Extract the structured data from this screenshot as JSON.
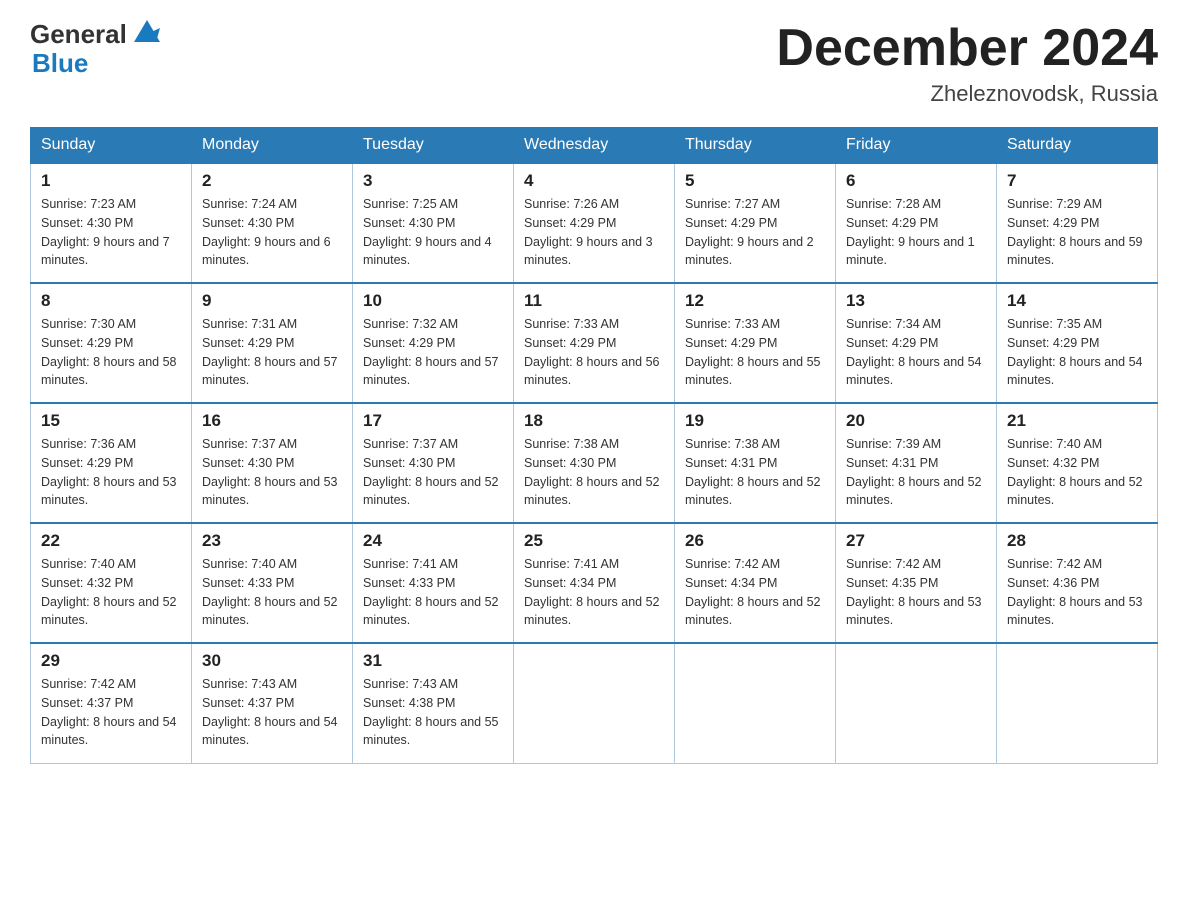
{
  "logo": {
    "text_general": "General",
    "text_blue": "Blue",
    "alt": "GeneralBlue logo"
  },
  "header": {
    "month_title": "December 2024",
    "location": "Zheleznovodsk, Russia"
  },
  "days_of_week": [
    "Sunday",
    "Monday",
    "Tuesday",
    "Wednesday",
    "Thursday",
    "Friday",
    "Saturday"
  ],
  "weeks": [
    [
      {
        "day": "1",
        "sunrise": "7:23 AM",
        "sunset": "4:30 PM",
        "daylight": "9 hours and 7 minutes."
      },
      {
        "day": "2",
        "sunrise": "7:24 AM",
        "sunset": "4:30 PM",
        "daylight": "9 hours and 6 minutes."
      },
      {
        "day": "3",
        "sunrise": "7:25 AM",
        "sunset": "4:30 PM",
        "daylight": "9 hours and 4 minutes."
      },
      {
        "day": "4",
        "sunrise": "7:26 AM",
        "sunset": "4:29 PM",
        "daylight": "9 hours and 3 minutes."
      },
      {
        "day": "5",
        "sunrise": "7:27 AM",
        "sunset": "4:29 PM",
        "daylight": "9 hours and 2 minutes."
      },
      {
        "day": "6",
        "sunrise": "7:28 AM",
        "sunset": "4:29 PM",
        "daylight": "9 hours and 1 minute."
      },
      {
        "day": "7",
        "sunrise": "7:29 AM",
        "sunset": "4:29 PM",
        "daylight": "8 hours and 59 minutes."
      }
    ],
    [
      {
        "day": "8",
        "sunrise": "7:30 AM",
        "sunset": "4:29 PM",
        "daylight": "8 hours and 58 minutes."
      },
      {
        "day": "9",
        "sunrise": "7:31 AM",
        "sunset": "4:29 PM",
        "daylight": "8 hours and 57 minutes."
      },
      {
        "day": "10",
        "sunrise": "7:32 AM",
        "sunset": "4:29 PM",
        "daylight": "8 hours and 57 minutes."
      },
      {
        "day": "11",
        "sunrise": "7:33 AM",
        "sunset": "4:29 PM",
        "daylight": "8 hours and 56 minutes."
      },
      {
        "day": "12",
        "sunrise": "7:33 AM",
        "sunset": "4:29 PM",
        "daylight": "8 hours and 55 minutes."
      },
      {
        "day": "13",
        "sunrise": "7:34 AM",
        "sunset": "4:29 PM",
        "daylight": "8 hours and 54 minutes."
      },
      {
        "day": "14",
        "sunrise": "7:35 AM",
        "sunset": "4:29 PM",
        "daylight": "8 hours and 54 minutes."
      }
    ],
    [
      {
        "day": "15",
        "sunrise": "7:36 AM",
        "sunset": "4:29 PM",
        "daylight": "8 hours and 53 minutes."
      },
      {
        "day": "16",
        "sunrise": "7:37 AM",
        "sunset": "4:30 PM",
        "daylight": "8 hours and 53 minutes."
      },
      {
        "day": "17",
        "sunrise": "7:37 AM",
        "sunset": "4:30 PM",
        "daylight": "8 hours and 52 minutes."
      },
      {
        "day": "18",
        "sunrise": "7:38 AM",
        "sunset": "4:30 PM",
        "daylight": "8 hours and 52 minutes."
      },
      {
        "day": "19",
        "sunrise": "7:38 AM",
        "sunset": "4:31 PM",
        "daylight": "8 hours and 52 minutes."
      },
      {
        "day": "20",
        "sunrise": "7:39 AM",
        "sunset": "4:31 PM",
        "daylight": "8 hours and 52 minutes."
      },
      {
        "day": "21",
        "sunrise": "7:40 AM",
        "sunset": "4:32 PM",
        "daylight": "8 hours and 52 minutes."
      }
    ],
    [
      {
        "day": "22",
        "sunrise": "7:40 AM",
        "sunset": "4:32 PM",
        "daylight": "8 hours and 52 minutes."
      },
      {
        "day": "23",
        "sunrise": "7:40 AM",
        "sunset": "4:33 PM",
        "daylight": "8 hours and 52 minutes."
      },
      {
        "day": "24",
        "sunrise": "7:41 AM",
        "sunset": "4:33 PM",
        "daylight": "8 hours and 52 minutes."
      },
      {
        "day": "25",
        "sunrise": "7:41 AM",
        "sunset": "4:34 PM",
        "daylight": "8 hours and 52 minutes."
      },
      {
        "day": "26",
        "sunrise": "7:42 AM",
        "sunset": "4:34 PM",
        "daylight": "8 hours and 52 minutes."
      },
      {
        "day": "27",
        "sunrise": "7:42 AM",
        "sunset": "4:35 PM",
        "daylight": "8 hours and 53 minutes."
      },
      {
        "day": "28",
        "sunrise": "7:42 AM",
        "sunset": "4:36 PM",
        "daylight": "8 hours and 53 minutes."
      }
    ],
    [
      {
        "day": "29",
        "sunrise": "7:42 AM",
        "sunset": "4:37 PM",
        "daylight": "8 hours and 54 minutes."
      },
      {
        "day": "30",
        "sunrise": "7:43 AM",
        "sunset": "4:37 PM",
        "daylight": "8 hours and 54 minutes."
      },
      {
        "day": "31",
        "sunrise": "7:43 AM",
        "sunset": "4:38 PM",
        "daylight": "8 hours and 55 minutes."
      },
      null,
      null,
      null,
      null
    ]
  ]
}
